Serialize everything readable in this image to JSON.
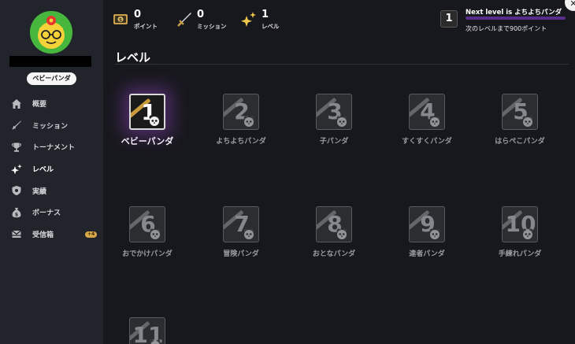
{
  "sidebar": {
    "rank_label": "ベビーパンダ",
    "nav": [
      {
        "label": "概要",
        "icon": "home-icon"
      },
      {
        "label": "ミッション",
        "icon": "sword-icon"
      },
      {
        "label": "トーナメント",
        "icon": "trophy-icon"
      },
      {
        "label": "レベル",
        "icon": "sparkle-icon",
        "active": true
      },
      {
        "label": "実績",
        "icon": "shield-icon"
      },
      {
        "label": "ボーナス",
        "icon": "money-bag-icon"
      },
      {
        "label": "受信箱",
        "icon": "inbox-icon",
        "badge": "+4"
      }
    ]
  },
  "topbar": {
    "points": {
      "value": "0",
      "label": "ポイント"
    },
    "missions": {
      "value": "0",
      "label": "ミッション"
    },
    "level": {
      "value": "1",
      "label": "レベル"
    },
    "next_level": {
      "title": "Next level is よちよちパンダ",
      "remaining": "次のレベルまで900ポイント",
      "current_badge": "1",
      "progress_percent": 0
    }
  },
  "main": {
    "title": "レベル",
    "levels": [
      {
        "number": "1",
        "name": "ベビーパンダ",
        "current": true
      },
      {
        "number": "2",
        "name": "よちよちパンダ"
      },
      {
        "number": "3",
        "name": "子パンダ"
      },
      {
        "number": "4",
        "name": "すくすくパンダ"
      },
      {
        "number": "5",
        "name": "はらぺこパンダ"
      },
      {
        "number": "6",
        "name": "おでかけパンダ"
      },
      {
        "number": "7",
        "name": "冒険パンダ"
      },
      {
        "number": "8",
        "name": "おとなパンダ"
      },
      {
        "number": "9",
        "name": "達者パンダ"
      },
      {
        "number": "10",
        "name": "手練れパンダ"
      },
      {
        "number": "11",
        "name": ""
      }
    ]
  },
  "colors": {
    "sidebar_bg": "#22242b",
    "main_bg": "#17181d",
    "accent_purple": "#5a2d8a",
    "badge_gold": "#d7a84a"
  }
}
